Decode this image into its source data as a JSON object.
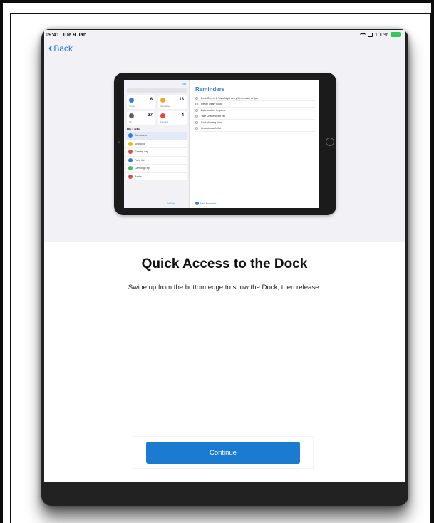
{
  "status_bar": {
    "time": "09:41",
    "date": "Tue 9 Jan",
    "battery": "100%"
  },
  "nav": {
    "back_label": "Back"
  },
  "illustration": {
    "lists_title": "My Lists",
    "edit_label": "Edit",
    "smart_lists": [
      {
        "label": "Today",
        "count": "8",
        "color": "#2f7de1"
      },
      {
        "label": "Scheduled",
        "count": "13",
        "color": "#f5a623"
      },
      {
        "label": "All",
        "count": "37",
        "color": "#5f5f66"
      },
      {
        "label": "Flagged",
        "count": "4",
        "color": "#e9453a"
      }
    ],
    "lists": [
      {
        "label": "Reminders",
        "color": "#2f7de1",
        "selected": true
      },
      {
        "label": "Shopping",
        "color": "#f5b700",
        "selected": false
      },
      {
        "label": "Gaming day",
        "color": "#e9453a",
        "selected": false
      },
      {
        "label": "Party list",
        "color": "#2f7de1",
        "selected": false
      },
      {
        "label": "Camping Trip",
        "color": "#34c759",
        "selected": false
      },
      {
        "label": "Books",
        "color": "#e9453a",
        "selected": false
      }
    ],
    "add_list": "Add List",
    "reminders_title": "Reminders",
    "reminders": [
      "Book Gavin's & Trivia Night every Wednesday at 8pm",
      "Return library books",
      "Bake cookies for picnic",
      "Take Charlie to the vet",
      "Book climbing class",
      "Groceries with Kat"
    ],
    "new_reminder": "New Reminder"
  },
  "content": {
    "title": "Quick Access to the Dock",
    "subtitle": "Swipe up from the bottom edge to show the Dock, then release."
  },
  "actions": {
    "continue_label": "Continue"
  },
  "colors": {
    "accent": "#1a7bd0",
    "hero_background": "#f2f2f6"
  }
}
